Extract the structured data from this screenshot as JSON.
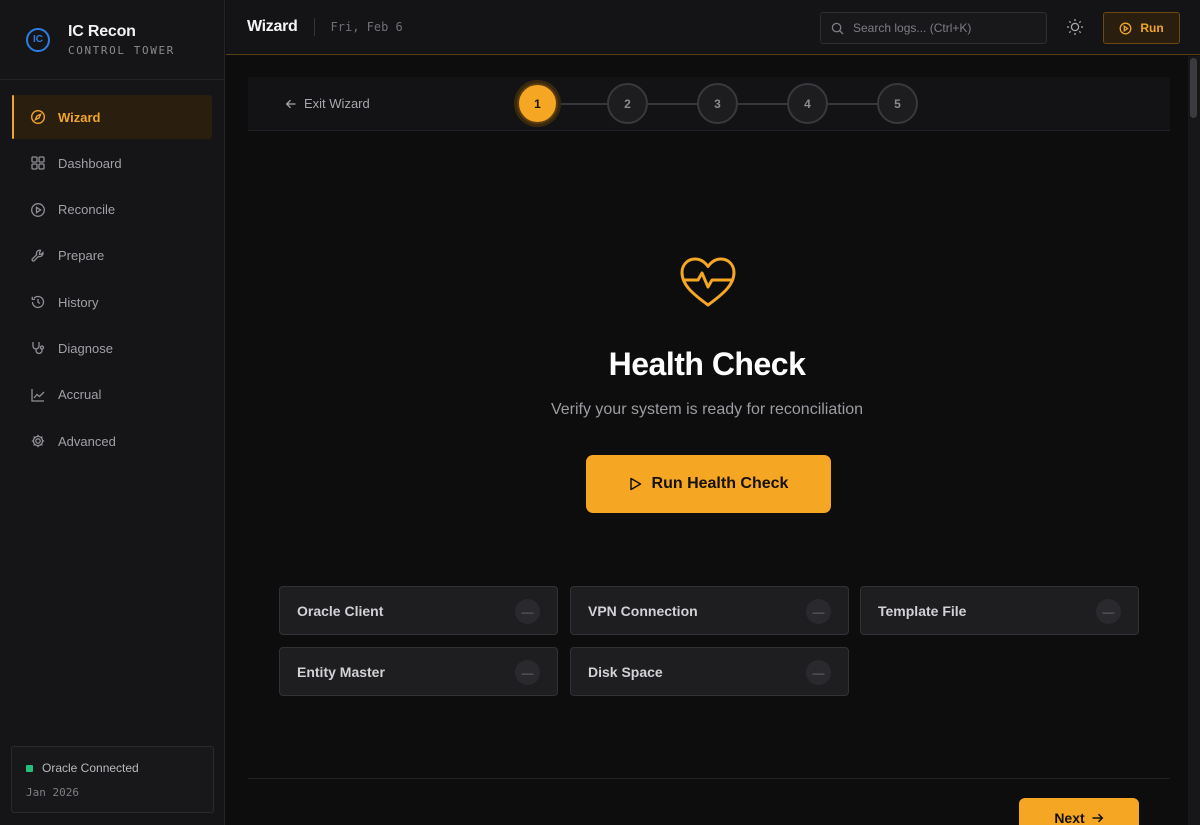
{
  "brand": {
    "logo_text": "IC",
    "title": "IC Recon",
    "subtitle": "CONTROL TOWER"
  },
  "sidebar": {
    "items": [
      {
        "label": "Wizard",
        "icon": "compass-icon",
        "active": true
      },
      {
        "label": "Dashboard",
        "icon": "grid-icon"
      },
      {
        "label": "Reconcile",
        "icon": "play-circle-icon"
      },
      {
        "label": "Prepare",
        "icon": "wrench-icon"
      },
      {
        "label": "History",
        "icon": "history-icon"
      },
      {
        "label": "Diagnose",
        "icon": "stethoscope-icon"
      },
      {
        "label": "Accrual",
        "icon": "line-chart-icon"
      },
      {
        "label": "Advanced",
        "icon": "gear-icon"
      }
    ],
    "status": {
      "label": "Oracle Connected",
      "date": "Jan 2026",
      "color": "#22c07a"
    }
  },
  "header": {
    "title": "Wizard",
    "date": "Fri, Feb 6",
    "search_placeholder": "Search logs... (Ctrl+K)",
    "run_label": "Run"
  },
  "wizard": {
    "exit_label": "Exit Wizard",
    "steps": [
      "1",
      "2",
      "3",
      "4",
      "5"
    ],
    "current_step": 1
  },
  "health": {
    "icon": "heart-pulse-icon",
    "title": "Health Check",
    "subtitle": "Verify your system is ready for reconciliation",
    "button_label": "Run Health Check",
    "checks": [
      {
        "label": "Oracle Client",
        "status": "—"
      },
      {
        "label": "VPN Connection",
        "status": "—"
      },
      {
        "label": "Template File",
        "status": "—"
      },
      {
        "label": "Entity Master",
        "status": "—"
      },
      {
        "label": "Disk Space",
        "status": "—"
      }
    ]
  },
  "footer": {
    "next_label": "Next"
  },
  "colors": {
    "accent": "#f5a623",
    "background": "#0d0d0e",
    "sidebar": "#151517",
    "status_ok": "#22c07a"
  }
}
